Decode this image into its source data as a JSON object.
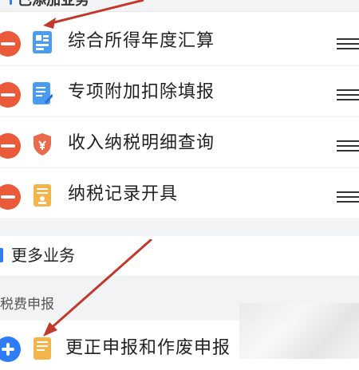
{
  "section": {
    "title": "已添加业务"
  },
  "rows": [
    {
      "label": "综合所得年度汇算",
      "icon": "tax-form-blue-icon",
      "action": "remove"
    },
    {
      "label": "专项附加扣除填报",
      "icon": "edit-document-blue-icon",
      "action": "remove"
    },
    {
      "label": "收入纳税明细查询",
      "icon": "shield-red-icon",
      "action": "remove"
    },
    {
      "label": "纳税记录开具",
      "icon": "document-orange-icon",
      "action": "remove"
    }
  ],
  "more": {
    "title": "更多业务"
  },
  "subcategory": {
    "label": "税费申报"
  },
  "more_rows": [
    {
      "label": "更正申报和作废申报",
      "icon": "document-orange-icon",
      "action": "add"
    }
  ],
  "colors": {
    "remove": "#ea5a3b",
    "add": "#2f7cf6",
    "accent": "#2f7cf6",
    "arrow": "#c0392b"
  }
}
